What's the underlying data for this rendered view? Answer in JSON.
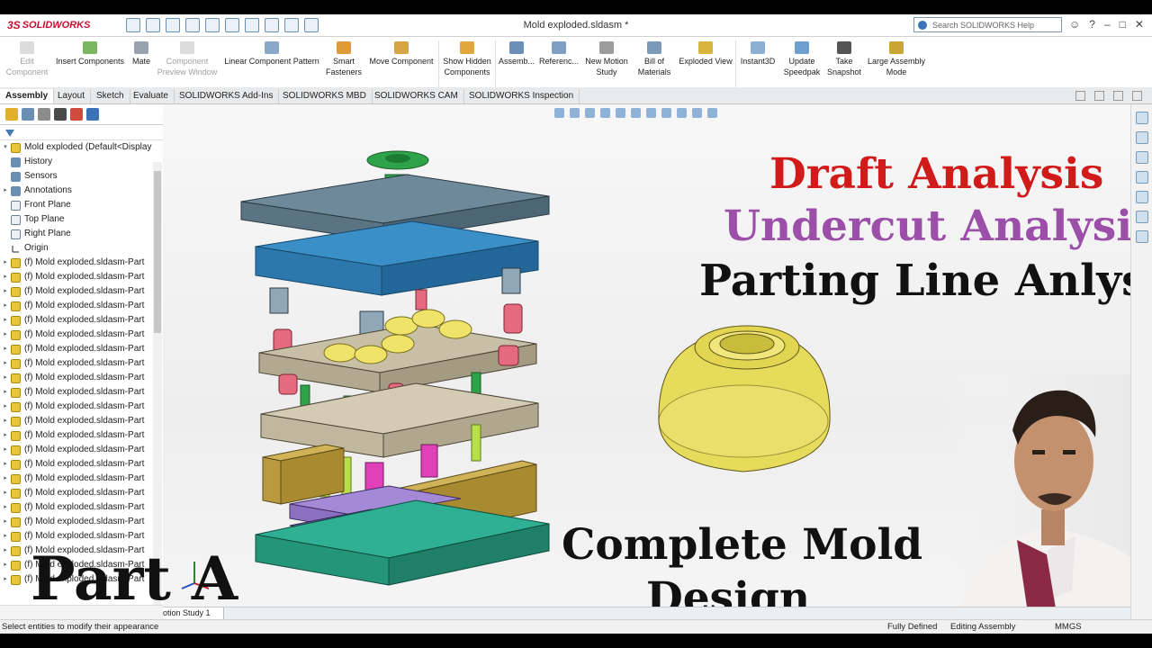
{
  "app": {
    "logo_text": "SOLIDWORKS",
    "logo_ds": "3S",
    "document_title": "Mold exploded.sldasm *",
    "help_search_placeholder": "Search SOLIDWORKS Help"
  },
  "ribbon": {
    "buttons": [
      {
        "label": "Edit\nComponent",
        "enabled": false
      },
      {
        "label": "Insert Components",
        "enabled": true
      },
      {
        "label": "Mate",
        "enabled": true
      },
      {
        "label": "Component\nPreview Window",
        "enabled": false
      },
      {
        "label": "Linear Component Pattern",
        "enabled": true
      },
      {
        "label": "Smart\nFasteners",
        "enabled": true
      },
      {
        "label": "Move Component",
        "enabled": true
      },
      {
        "label": "Show Hidden\nComponents",
        "enabled": true
      },
      {
        "label": "Assemb...",
        "enabled": true
      },
      {
        "label": "Referenc...",
        "enabled": true
      },
      {
        "label": "New Motion\nStudy",
        "enabled": true
      },
      {
        "label": "Bill of\nMaterials",
        "enabled": true
      },
      {
        "label": "Exploded View",
        "enabled": true
      },
      {
        "label": "Instant3D",
        "enabled": true
      },
      {
        "label": "Update\nSpeedpak",
        "enabled": true
      },
      {
        "label": "Take\nSnapshot",
        "enabled": true
      },
      {
        "label": "Large Assembly\nMode",
        "enabled": true
      }
    ]
  },
  "tabs": [
    "Assembly",
    "Layout",
    "Sketch",
    "Evaluate",
    "SOLIDWORKS Add-Ins",
    "SOLIDWORKS MBD",
    "SOLIDWORKS CAM",
    "SOLIDWORKS Inspection"
  ],
  "tree": {
    "root": "Mold exploded  (Default<Display",
    "items": [
      {
        "label": "History",
        "icon": "history-icon"
      },
      {
        "label": "Sensors",
        "icon": "sensors-icon"
      },
      {
        "label": "Annotations",
        "icon": "annotations-icon"
      },
      {
        "label": "Front Plane",
        "icon": "plane-icon"
      },
      {
        "label": "Top Plane",
        "icon": "plane-icon"
      },
      {
        "label": "Right Plane",
        "icon": "plane-icon"
      },
      {
        "label": "Origin",
        "icon": "origin-icon"
      }
    ],
    "part_label": "(f) Mold exploded.sldasm-Part",
    "part_rows": 23
  },
  "overlay": {
    "line1": "Draft Analysis",
    "line2": "Undercut Analysis",
    "line3": "Parting Line Anlysis",
    "line4": "Complete Mold",
    "line5": "Design",
    "part_a": "Part A"
  },
  "bottom_tab": "otion Study 1",
  "status": {
    "hint": "Select entities to modify their appearance",
    "state": "Fully Defined",
    "mode": "Editing Assembly",
    "units": "MMGS"
  },
  "colors": {
    "title_red": "#d11a1a",
    "title_purple": "#9b4fa8",
    "plate_blue": "#2f7fb5",
    "plate_teal": "#1f9a82",
    "part_yellow": "#e8d85a"
  }
}
